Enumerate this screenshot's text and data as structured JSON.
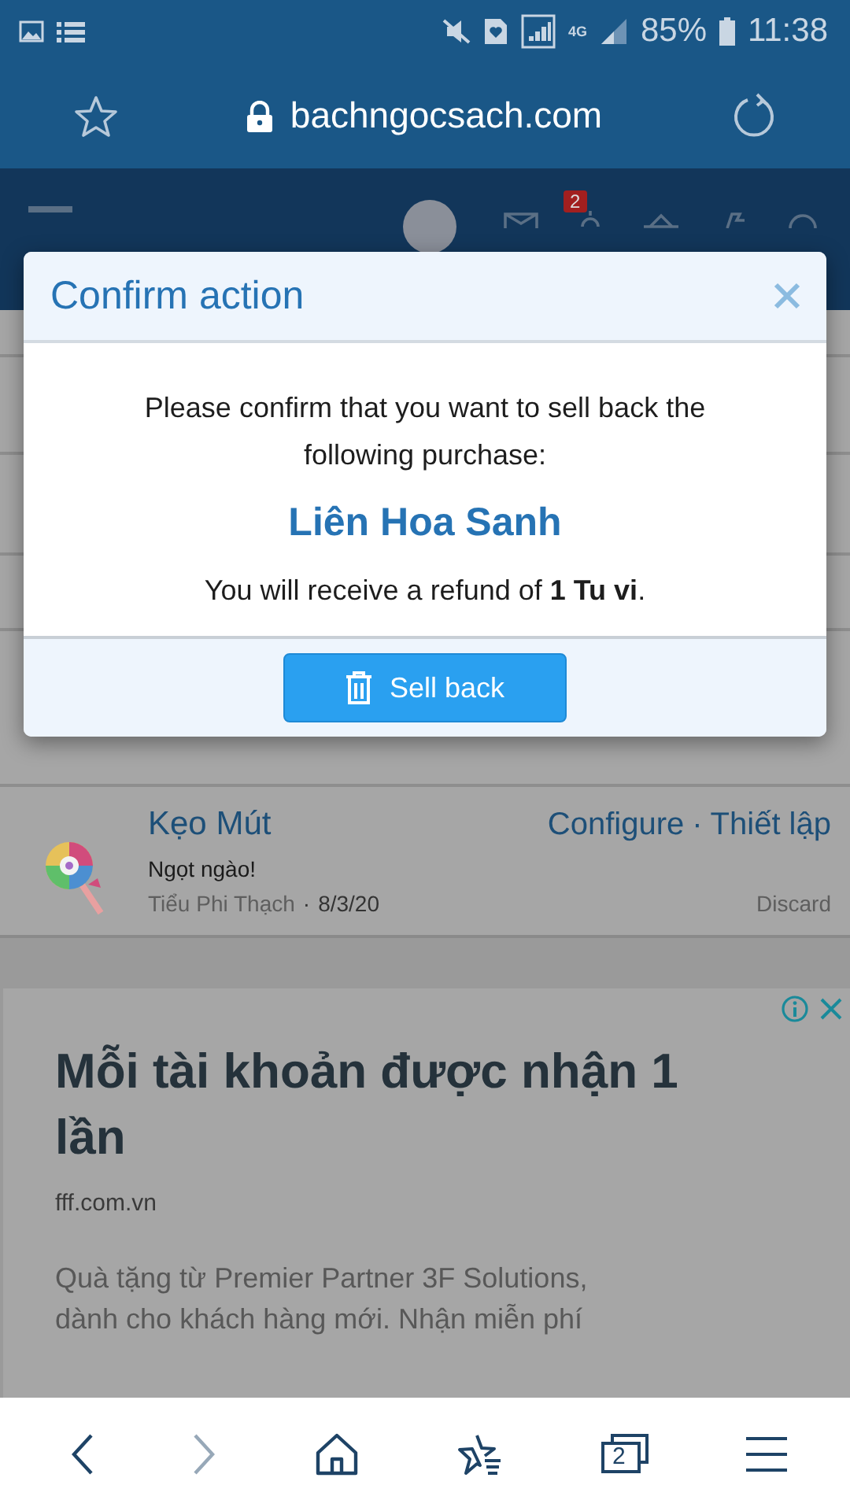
{
  "status_bar": {
    "network": "4G",
    "battery": "85%",
    "time": "11:38"
  },
  "browser": {
    "url": "bachngocsach.com"
  },
  "site_nav": {
    "notification_badge": "2"
  },
  "dialog": {
    "title": "Confirm action",
    "message": "Please confirm that you want to sell back the following purchase:",
    "item": "Liên Hoa Sanh",
    "refund": "You will receive a refund of **1 Tu vi**.",
    "button": "Sell back"
  },
  "purchase": {
    "name": "Kẹo Mút",
    "actions": [
      "Configure",
      "Thiết lập"
    ],
    "separator": "·",
    "description": "Ngọt ngào!",
    "author": "Tiểu Phi Thạch",
    "date": "8/3/20",
    "discard": "Discard"
  },
  "ad": {
    "headline": "Mỗi tài khoản được nhận 1 lần",
    "domain": "fff.com.vn",
    "body": "Quà tặng từ Premier Partner 3F Solutions, dành cho khách hàng mới. Nhận miễn phí"
  },
  "bottom_nav": {
    "forward_disabled": true,
    "tab_count": "2"
  }
}
